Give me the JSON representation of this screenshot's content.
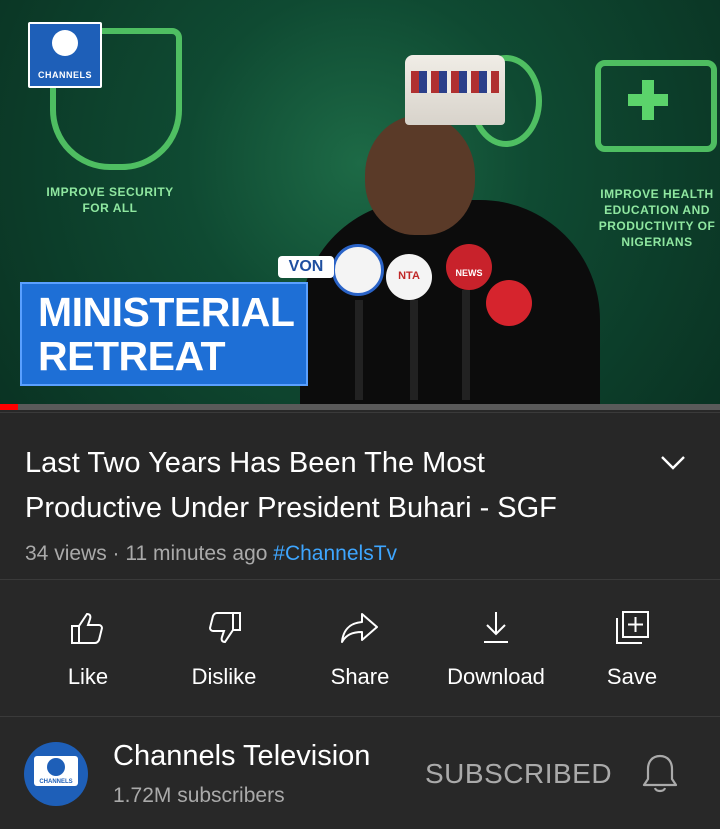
{
  "video": {
    "brand_label": "CHANNELS",
    "lower_third_line1": "MINISTERIAL",
    "lower_third_line2": "RETREAT",
    "bg_caption_left_1": "IMPROVE SECURITY",
    "bg_caption_left_2": "FOR ALL",
    "bg_caption_right_1": "IMPROVE HEALTH",
    "bg_caption_right_2": "EDUCATION AND",
    "bg_caption_right_3": "PRODUCTIVITY OF",
    "bg_caption_right_4": "NIGERIANS",
    "mic_labels": [
      "VON",
      "NTA",
      "NEWS"
    ],
    "progress_fraction": 0.025
  },
  "details": {
    "title": "Last Two Years Has Been The Most Productive Under President Buhari - SGF",
    "views": "34 views",
    "separator": "·",
    "age": "11 minutes ago",
    "hashtag": "#ChannelsTv"
  },
  "actions": [
    {
      "label": "Like",
      "icon": "thumbs-up-icon"
    },
    {
      "label": "Dislike",
      "icon": "thumbs-down-icon"
    },
    {
      "label": "Share",
      "icon": "share-icon"
    },
    {
      "label": "Download",
      "icon": "download-icon"
    },
    {
      "label": "Save",
      "icon": "add-to-playlist-icon"
    }
  ],
  "channel": {
    "name": "Channels Television",
    "subscribers": "1.72M subscribers",
    "subscribe_state": "SUBSCRIBED",
    "avatar_label": "CHANNELS"
  },
  "colors": {
    "accent_link": "#3ea6ff",
    "progress": "#ff0000",
    "background": "#282828"
  }
}
